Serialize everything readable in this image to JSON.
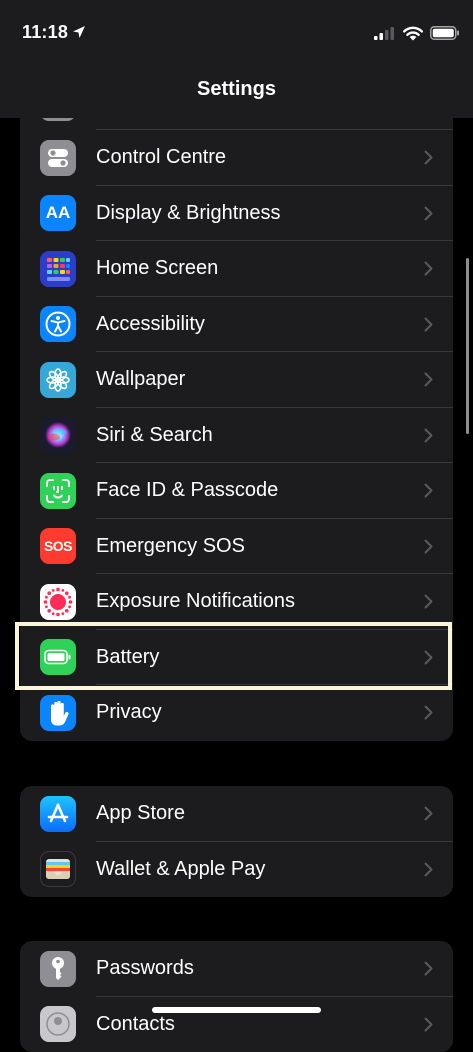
{
  "status_bar": {
    "time": "11:18"
  },
  "header": {
    "title": "Settings"
  },
  "groups": [
    {
      "items": [
        {
          "label": "Control Centre",
          "icon": "control-centre-icon",
          "color": "#8e8e93"
        },
        {
          "label": "Display & Brightness",
          "icon": "display-brightness-icon",
          "color": "#0a84ff"
        },
        {
          "label": "Home Screen",
          "icon": "home-screen-icon",
          "color": "#2c3ec9"
        },
        {
          "label": "Accessibility",
          "icon": "accessibility-icon",
          "color": "#0a84ff"
        },
        {
          "label": "Wallpaper",
          "icon": "wallpaper-icon",
          "color": "#35a8d8"
        },
        {
          "label": "Siri & Search",
          "icon": "siri-icon",
          "color": "#1b1b2e"
        },
        {
          "label": "Face ID & Passcode",
          "icon": "face-id-icon",
          "color": "#30d158"
        },
        {
          "label": "Emergency SOS",
          "icon": "sos-icon",
          "color": "#ff3b30",
          "icon_text": "SOS"
        },
        {
          "label": "Exposure Notifications",
          "icon": "exposure-notifications-icon",
          "color": "#ffffff"
        },
        {
          "label": "Battery",
          "icon": "battery-icon",
          "color": "#30d158"
        },
        {
          "label": "Privacy",
          "icon": "privacy-hand-icon",
          "color": "#0a84ff"
        }
      ]
    },
    {
      "items": [
        {
          "label": "App Store",
          "icon": "app-store-icon",
          "color": "#0a84ff"
        },
        {
          "label": "Wallet & Apple Pay",
          "icon": "wallet-icon",
          "color": "#1c1c1e"
        }
      ]
    },
    {
      "items": [
        {
          "label": "Passwords",
          "icon": "key-icon",
          "color": "#8e8e93"
        },
        {
          "label": "Contacts",
          "icon": "contacts-icon",
          "color": "#c7c7cc"
        }
      ]
    }
  ],
  "highlighted_item": "Battery"
}
